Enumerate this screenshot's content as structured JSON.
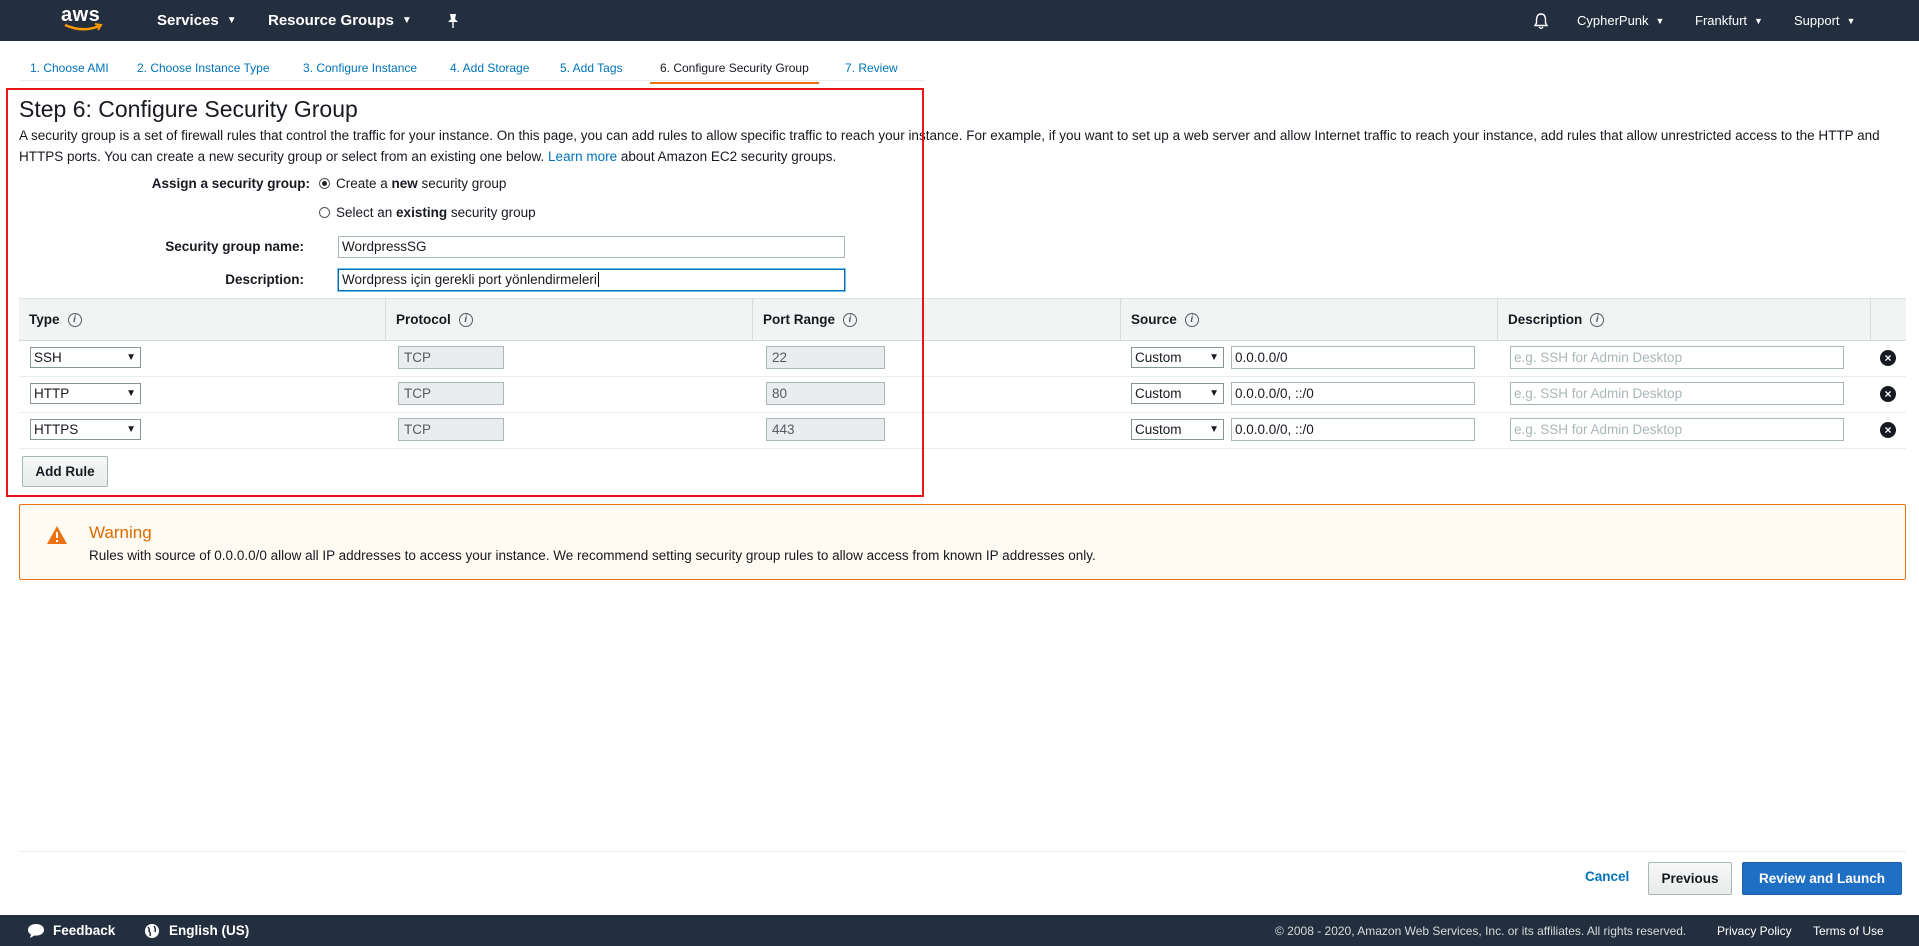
{
  "nav": {
    "logo": "aws",
    "services": "Services",
    "resource_groups": "Resource Groups",
    "user": "CypherPunk",
    "region": "Frankfurt",
    "support": "Support"
  },
  "steps": [
    {
      "label": "1. Choose AMI"
    },
    {
      "label": "2. Choose Instance Type"
    },
    {
      "label": "3. Configure Instance"
    },
    {
      "label": "4. Add Storage"
    },
    {
      "label": "5. Add Tags"
    },
    {
      "label": "6. Configure Security Group",
      "active": true
    },
    {
      "label": "7. Review"
    }
  ],
  "page": {
    "title": "Step 6: Configure Security Group",
    "intro_text": "A security group is a set of firewall rules that control the traffic for your instance. On this page, you can add rules to allow specific traffic to reach your instance. For example, if you want to set up a web server and allow Internet traffic to reach your instance, add rules that allow unrestricted access to the HTTP and HTTPS ports. You can create a new security group or select from an existing one below.",
    "learn_more": "Learn more",
    "intro_suffix": "about Amazon EC2 security groups."
  },
  "form": {
    "assign_label": "Assign a security group:",
    "option_new_pre": "Create a ",
    "option_new_bold": "new",
    "option_new_post": " security group",
    "option_existing_pre": "Select an ",
    "option_existing_bold": "existing",
    "option_existing_post": " security group",
    "name_label": "Security group name:",
    "name_value": "WordpressSG",
    "desc_label": "Description:",
    "desc_value": "Wordpress için gerekli port yönlendirmeleri"
  },
  "table": {
    "headers": {
      "type": "Type",
      "protocol": "Protocol",
      "port_range": "Port Range",
      "source": "Source",
      "description": "Description"
    },
    "info_glyph": "i",
    "rows": [
      {
        "type": "SSH",
        "protocol": "TCP",
        "port": "22",
        "source_mode": "Custom",
        "source": "0.0.0.0/0",
        "desc_placeholder": "e.g. SSH for Admin Desktop"
      },
      {
        "type": "HTTP",
        "protocol": "TCP",
        "port": "80",
        "source_mode": "Custom",
        "source": "0.0.0.0/0, ::/0",
        "desc_placeholder": "e.g. SSH for Admin Desktop"
      },
      {
        "type": "HTTPS",
        "protocol": "TCP",
        "port": "443",
        "source_mode": "Custom",
        "source": "0.0.0.0/0, ::/0",
        "desc_placeholder": "e.g. SSH for Admin Desktop"
      }
    ],
    "add_rule": "Add Rule"
  },
  "warning": {
    "title": "Warning",
    "text": "Rules with source of 0.0.0.0/0 allow all IP addresses to access your instance. We recommend setting security group rules to allow access from known IP addresses only."
  },
  "actions": {
    "cancel": "Cancel",
    "previous": "Previous",
    "review_launch": "Review and Launch"
  },
  "footer": {
    "feedback": "Feedback",
    "language": "English (US)",
    "copyright": "© 2008 - 2020, Amazon Web Services, Inc. or its affiliates. All rights reserved.",
    "privacy": "Privacy Policy",
    "terms": "Terms of Use"
  },
  "colors": {
    "nav_bg": "#232f3e",
    "link": "#0073bb",
    "active_step": "#ec7211",
    "primary_button": "#1f6fc5",
    "warning": "#db6b00",
    "highlight_box": "#e8161a"
  }
}
